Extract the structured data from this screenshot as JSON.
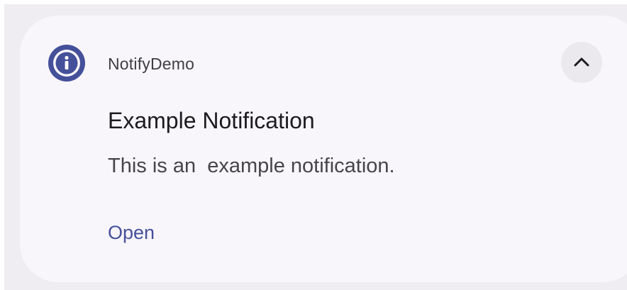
{
  "notification": {
    "app_name": "NotifyDemo",
    "app_icon": "info-icon",
    "expand_icon": "chevron-up-icon",
    "title": "Example Notification",
    "body": "This is an  example notification.",
    "action_label": "Open"
  },
  "colors": {
    "accent": "#45509a",
    "card_background": "#f8f6fb",
    "page_background": "#efedf1",
    "expand_button_background": "#ebe8ee"
  }
}
